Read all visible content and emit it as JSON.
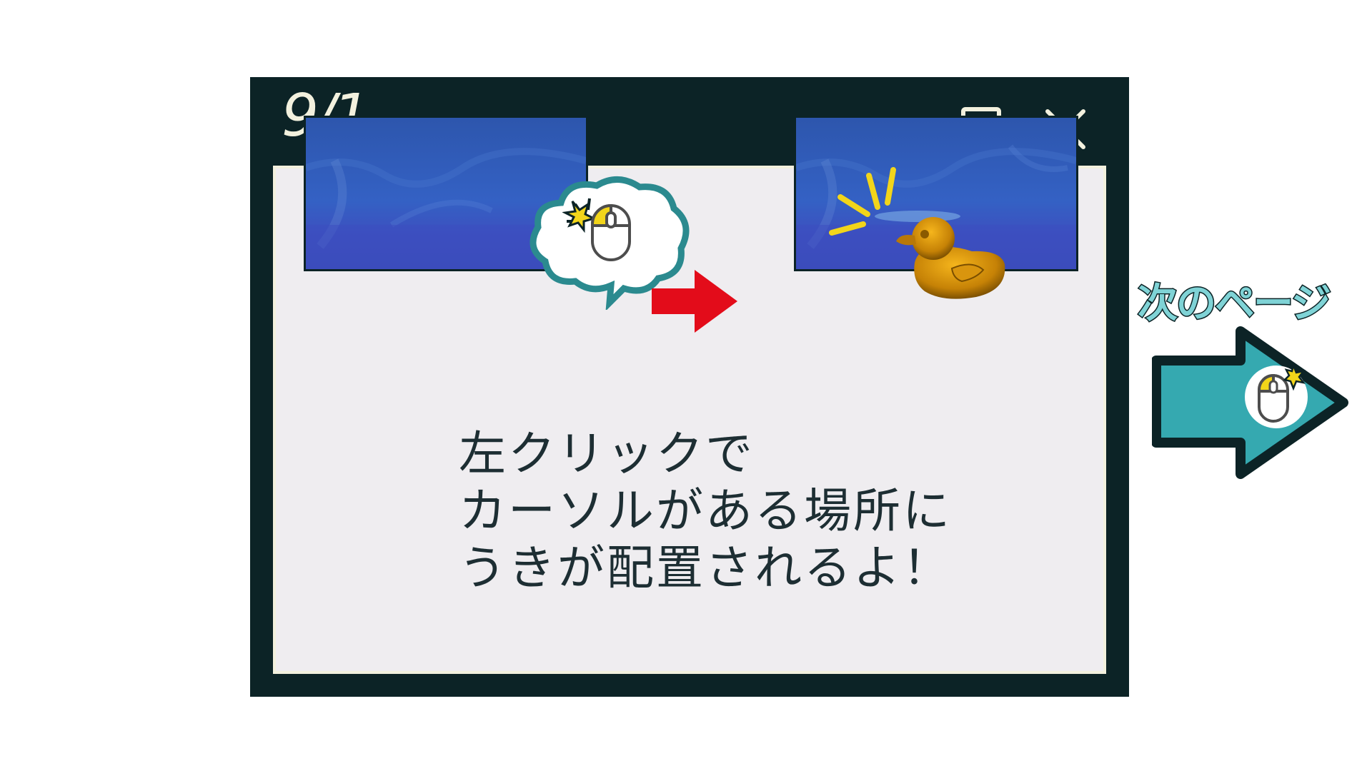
{
  "window": {
    "page_counter": "9/1",
    "controls": {
      "minimize": "minimize-icon",
      "restore": "restore-icon",
      "close": "close-icon"
    }
  },
  "illustration": {
    "before_scene": "water-scene",
    "click_bubble_icon": "mouse-left-click-icon",
    "arrow_color": "#e30c1a",
    "after_scene": "water-scene-with-float",
    "float_icon": "rubber-duck-float-icon"
  },
  "instruction": {
    "lines": [
      "左クリックで",
      "カーソルがある場所に",
      "うきが配置されるよ！"
    ]
  },
  "next": {
    "label": "次のページ",
    "icon": "mouse-left-click-icon",
    "color": "#35a9b0"
  }
}
